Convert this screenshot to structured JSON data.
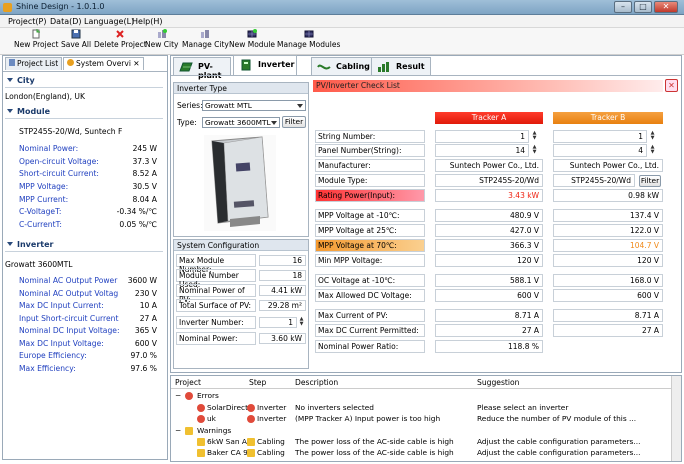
{
  "app": {
    "title": "Shine Design - 1.0.1.0"
  },
  "menu": [
    "Project(P)",
    "Data(D)",
    "Language(L)",
    "Help(H)"
  ],
  "toolbar": [
    "New Project",
    "Save All",
    "Delete Project",
    "New City",
    "Manage City",
    "New Module",
    "Manage Modules"
  ],
  "left": {
    "tabs": [
      "Project List",
      "System Overvi"
    ],
    "city": {
      "header": "City",
      "value": "London(England), UK"
    },
    "module": {
      "header": "Module",
      "name": "STP245S-20/Wd, Suntech F",
      "rows": [
        {
          "label": "Nominal Power:",
          "value": "245 W"
        },
        {
          "label": "Open-circuit Voltage:",
          "value": "37.3 V"
        },
        {
          "label": "Short-circuit Current:",
          "value": "8.52 A"
        },
        {
          "label": "MPP Voltage:",
          "value": "30.5 V"
        },
        {
          "label": "MPP Current:",
          "value": "8.04 A"
        },
        {
          "label": "C-VoltageT:",
          "value": "-0.34 %/℃"
        },
        {
          "label": "C-CurrentT:",
          "value": "0.05 %/℃"
        }
      ]
    },
    "inverter": {
      "header": "Inverter",
      "name": "Growatt 3600MTL",
      "rows": [
        {
          "label": "Nominal AC Output Power",
          "value": "3600 W"
        },
        {
          "label": "Nominal AC Output Voltag",
          "value": "230 V"
        },
        {
          "label": "Max DC Input Current:",
          "value": "10 A"
        },
        {
          "label": "Input Short-circuit Current",
          "value": "27 A"
        },
        {
          "label": "Nominal DC Input Voltage:",
          "value": "365 V"
        },
        {
          "label": "Max DC Input Voltage:",
          "value": "600 V"
        },
        {
          "label": "Europe Efficiency:",
          "value": "97.0 %"
        },
        {
          "label": "Max Efficiency:",
          "value": "97.6 %"
        }
      ]
    }
  },
  "main": {
    "tabs": [
      "PV-plant",
      "Inverter",
      "Cabling",
      "Result"
    ],
    "inverter_type": {
      "header": "Inverter Type",
      "series_label": "Series:",
      "series_value": "Growatt MTL",
      "type_label": "Type:",
      "type_value": "Growatt 3600MTL",
      "filter": "Filter"
    },
    "system_config": {
      "header": "System Configuration",
      "rows": [
        {
          "label": "Max Module Number:",
          "value": "16"
        },
        {
          "label": "Module Number Used:",
          "value": "18"
        },
        {
          "label": "Nominal Power of PV:",
          "value": "4.41 kW"
        },
        {
          "label": "Total Surface of PV:",
          "value": "29.28 m²"
        },
        {
          "label": "Inverter Number:",
          "value": "1"
        },
        {
          "label": "Nominal Power:",
          "value": "3.60 kW"
        }
      ]
    },
    "check": {
      "title": "PV/Inverter Check List",
      "close": "✕",
      "tracker_a": "Tracker A",
      "tracker_b": "Tracker B",
      "filter": "Filter",
      "rows": [
        {
          "label": "String Number:",
          "a": "1",
          "b": "1",
          "spin": true
        },
        {
          "label": "Panel Number(String):",
          "a": "14",
          "b": "4",
          "spin": true
        },
        {
          "label": "Manufacturer:",
          "a": "Suntech Power Co., Ltd.",
          "b": "Suntech Power Co., Ltd."
        },
        {
          "label": "Module Type:",
          "a": "STP245S-20/Wd",
          "b": "STP245S-20/Wd"
        },
        {
          "label": "Rating Power(Input):",
          "a": "3.43 kW",
          "b": "0.98 kW",
          "style": "red"
        },
        {
          "label": "MPP Voltage at -10℃:",
          "a": "480.9 V",
          "b": "137.4 V"
        },
        {
          "label": "MPP Voltage at 25℃:",
          "a": "427.0 V",
          "b": "122.0 V"
        },
        {
          "label": "MPP Voltage at 70℃:",
          "a": "366.3 V",
          "b": "104.7 V",
          "style": "orange"
        },
        {
          "label": "Min MPP Voltage:",
          "a": "120 V",
          "b": "120 V"
        },
        {
          "label": "OC Voltage at -10℃:",
          "a": "588.1 V",
          "b": "168.0 V"
        },
        {
          "label": "Max Allowed DC Voltage:",
          "a": "600 V",
          "b": "600 V"
        },
        {
          "label": "Max Current of PV:",
          "a": "8.71 A",
          "b": "8.71 A"
        },
        {
          "label": "Max DC Current Permitted:",
          "a": "27 A",
          "b": "27 A"
        },
        {
          "label": "Nominal Power Ratio:",
          "a": "118.8 %",
          "b": ""
        }
      ]
    }
  },
  "messages": {
    "headers": [
      "Project",
      "Step",
      "Description",
      "Suggestion"
    ],
    "errors_label": "Errors",
    "warnings_label": "Warnings",
    "errors": [
      {
        "project": "SolarDirect",
        "step": "Inverter",
        "description": "No inverters selected",
        "suggestion": "Please select an inverter"
      },
      {
        "project": "uk",
        "step": "Inverter",
        "description": "(MPP Tracker A) Input power is too high",
        "suggestion": "Reduce the number of PV module of this ..."
      }
    ],
    "warnings": [
      {
        "project": "6kW San A",
        "step": "Cabling",
        "description": "The power loss of the AC-side cable is high",
        "suggestion": "Adjust the cable configuration parameters..."
      },
      {
        "project": "Baker CA 9",
        "step": "Cabling",
        "description": "The power loss of the AC-side cable is high",
        "suggestion": "Adjust the cable configuration parameters..."
      }
    ]
  },
  "colors": {
    "accent": "#1f3fbf",
    "tracker_a": "#ee2211",
    "tracker_b": "#f08a1a",
    "error": "#e04a3a",
    "warning": "#f0c030"
  }
}
